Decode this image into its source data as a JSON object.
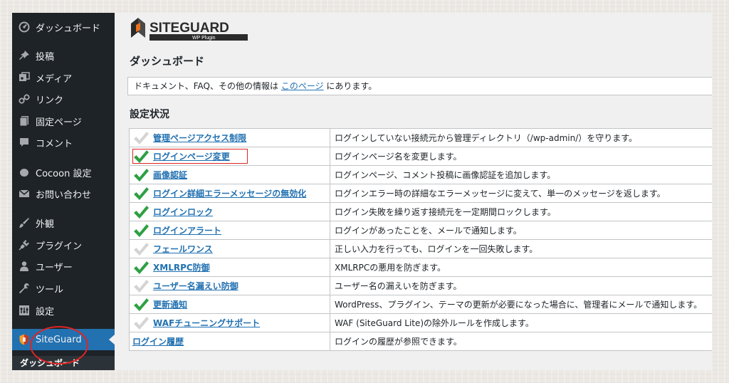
{
  "sidebar": {
    "items": [
      {
        "label": "ダッシュボード",
        "icon": "dashboard-icon"
      },
      {
        "label": "投稿",
        "icon": "pin-icon"
      },
      {
        "label": "メディア",
        "icon": "media-icon"
      },
      {
        "label": "リンク",
        "icon": "link-icon"
      },
      {
        "label": "固定ページ",
        "icon": "page-icon"
      },
      {
        "label": "コメント",
        "icon": "comment-icon"
      },
      {
        "label": "Cocoon 設定",
        "icon": "cocoon-icon"
      },
      {
        "label": "お問い合わせ",
        "icon": "mail-icon"
      },
      {
        "label": "外観",
        "icon": "brush-icon"
      },
      {
        "label": "プラグイン",
        "icon": "plugin-icon"
      },
      {
        "label": "ユーザー",
        "icon": "user-icon"
      },
      {
        "label": "ツール",
        "icon": "wrench-icon"
      },
      {
        "label": "設定",
        "icon": "settings-icon"
      },
      {
        "label": "SiteGuard",
        "icon": "shield-icon",
        "active": true
      }
    ],
    "submenu": {
      "label": "ダッシュボード"
    }
  },
  "logo": {
    "title": "SITEGUARD",
    "subtitle": "WP Plugin"
  },
  "page": {
    "title": "ダッシュボード",
    "notice": {
      "before": "ドキュメント、FAQ、その他の情報は ",
      "link": "このページ",
      "after": " にあります。"
    },
    "section_title": "設定状況"
  },
  "features": [
    {
      "name": "管理ページアクセス制限",
      "desc": "ログインしていない接続元から管理ディレクトリ（/wp-admin/）を守ります。",
      "enabled": false
    },
    {
      "name": "ログインページ変更",
      "desc": "ログインページ名を変更します。",
      "enabled": true,
      "highlighted": true
    },
    {
      "name": "画像認証",
      "desc": "ログインページ、コメント投稿に画像認証を追加します。",
      "enabled": true
    },
    {
      "name": "ログイン詳細エラーメッセージの無効化",
      "desc": "ログインエラー時の詳細なエラーメッセージに変えて、単一のメッセージを返します。",
      "enabled": true
    },
    {
      "name": "ログインロック",
      "desc": "ログイン失敗を繰り返す接続元を一定期間ロックします。",
      "enabled": true
    },
    {
      "name": "ログインアラート",
      "desc": "ログインがあったことを、メールで通知します。",
      "enabled": true
    },
    {
      "name": "フェールワンス",
      "desc": "正しい入力を行っても、ログインを一回失敗します。",
      "enabled": false
    },
    {
      "name": "XMLRPC防御",
      "desc": "XMLRPCの悪用を防ぎます。",
      "enabled": true
    },
    {
      "name": "ユーザー名漏えい防御",
      "desc": "ユーザー名の漏えいを防ぎます。",
      "enabled": false
    },
    {
      "name": "更新通知",
      "desc": "WordPress、プラグイン、テーマの更新が必要になった場合に、管理者にメールで通知します。",
      "enabled": true
    },
    {
      "name": "WAFチューニングサポート",
      "desc": "WAF (SiteGuard Lite)の除外ルールを作成します。",
      "enabled": false
    },
    {
      "name": "ログイン履歴",
      "desc": "ログインの履歴が参照できます。",
      "enabled": null
    }
  ],
  "colors": {
    "sidebar_bg": "#1d2327",
    "active_bg": "#2271b1",
    "link": "#2271b1",
    "check_on": "#2ea043",
    "check_off": "#d4d4d4",
    "annotation": "#e02424"
  }
}
